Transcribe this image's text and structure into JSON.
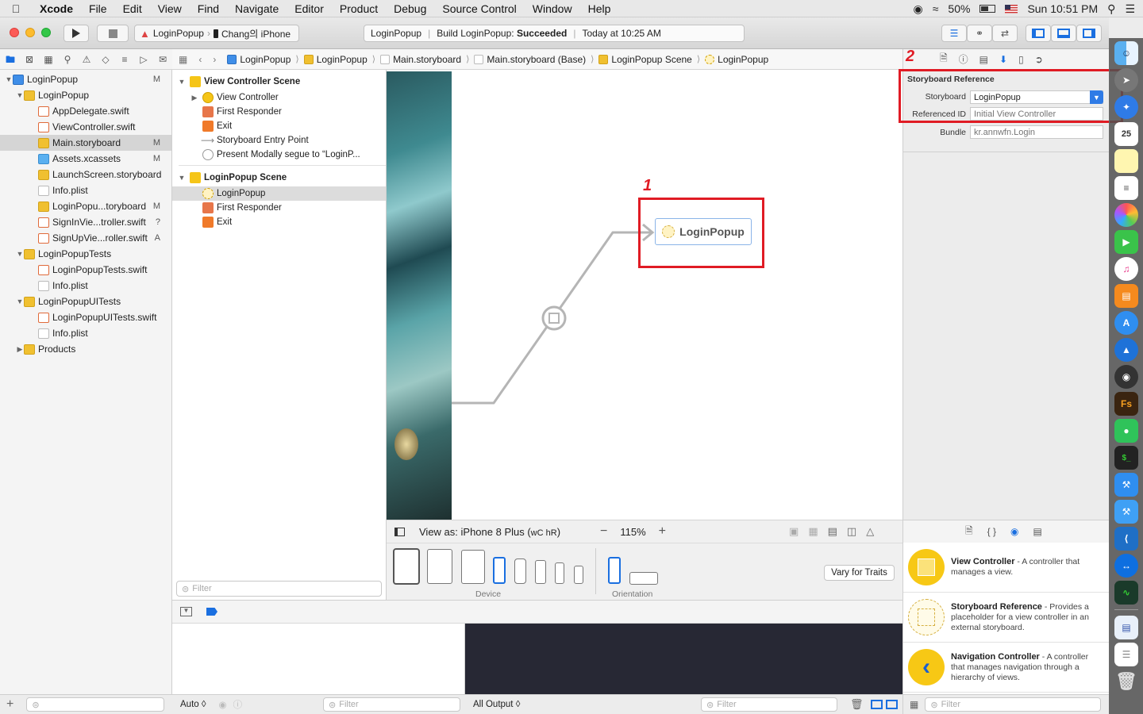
{
  "menubar": {
    "app": "Xcode",
    "items": [
      "File",
      "Edit",
      "View",
      "Find",
      "Navigate",
      "Editor",
      "Product",
      "Debug",
      "Source Control",
      "Window",
      "Help"
    ],
    "battery": "50%",
    "clock": "Sun 10:51 PM"
  },
  "toolbar": {
    "scheme": "LoginPopup",
    "destination": "Chang의 iPhone",
    "status_project": "LoginPopup",
    "status_prefix": "Build LoginPopup:",
    "status_result": "Succeeded",
    "status_time": "Today at 10:25 AM"
  },
  "navigator": {
    "rows": [
      {
        "label": "LoginPopup",
        "badge": "M"
      },
      {
        "label": "LoginPopup",
        "badge": ""
      },
      {
        "label": "AppDelegate.swift",
        "badge": ""
      },
      {
        "label": "ViewController.swift",
        "badge": ""
      },
      {
        "label": "Main.storyboard",
        "badge": "M"
      },
      {
        "label": "Assets.xcassets",
        "badge": "M"
      },
      {
        "label": "LaunchScreen.storyboard",
        "badge": ""
      },
      {
        "label": "Info.plist",
        "badge": ""
      },
      {
        "label": "LoginPopu...toryboard",
        "badge": "M"
      },
      {
        "label": "SignInVie...troller.swift",
        "badge": "?"
      },
      {
        "label": "SignUpVie...roller.swift",
        "badge": "A"
      },
      {
        "label": "LoginPopupTests",
        "badge": ""
      },
      {
        "label": "LoginPopupTests.swift",
        "badge": ""
      },
      {
        "label": "Info.plist",
        "badge": ""
      },
      {
        "label": "LoginPopupUITests",
        "badge": ""
      },
      {
        "label": "LoginPopupUITests.swift",
        "badge": ""
      },
      {
        "label": "Info.plist",
        "badge": ""
      },
      {
        "label": "Products",
        "badge": ""
      }
    ]
  },
  "jumpbar": [
    "LoginPopup",
    "LoginPopup",
    "Main.storyboard",
    "Main.storyboard (Base)",
    "LoginPopup Scene",
    "LoginPopup"
  ],
  "outline": {
    "scene1": "View Controller Scene",
    "scene1_items": [
      "View Controller",
      "First Responder",
      "Exit",
      "Storyboard Entry Point",
      "Present Modally segue to “LoginP..."
    ],
    "scene2": "LoginPopup Scene",
    "scene2_items": [
      "LoginPopup",
      "First Responder",
      "Exit"
    ],
    "filter_placeholder": "Filter"
  },
  "canvas": {
    "ref_label": "LoginPopup",
    "annotation_1": "1",
    "annotation_2": "2"
  },
  "viewas": {
    "label": "View as: iPhone 8 Plus (",
    "traits": "wC hR",
    "close": ")",
    "zoom": "115%"
  },
  "devicebar": {
    "device_label": "Device",
    "orientation_label": "Orientation",
    "vary_button": "Vary for Traits"
  },
  "inspector": {
    "section_title": "Storyboard Reference",
    "storyboard_label": "Storyboard",
    "storyboard_value": "LoginPopup",
    "refid_label": "Referenced ID",
    "refid_placeholder": "Initial View Controller",
    "bundle_label": "Bundle",
    "bundle_placeholder": "kr.annwfn.Login"
  },
  "library": [
    {
      "title": "View Controller",
      "desc": " - A controller that manages a view."
    },
    {
      "title": "Storyboard Reference",
      "desc": " - Provides a placeholder for a view controller in an external storyboard."
    },
    {
      "title": "Navigation Controller",
      "desc": " - A controller that manages navigation through a hierarchy of views."
    }
  ],
  "debug": {
    "auto_label": "Auto ◊",
    "output_label": "All Output ◊",
    "filter_placeholder": "Filter"
  },
  "colors": {
    "accent": "#1a6fe0",
    "annotation_red": "#e01b24",
    "console_bg": "#272834"
  }
}
